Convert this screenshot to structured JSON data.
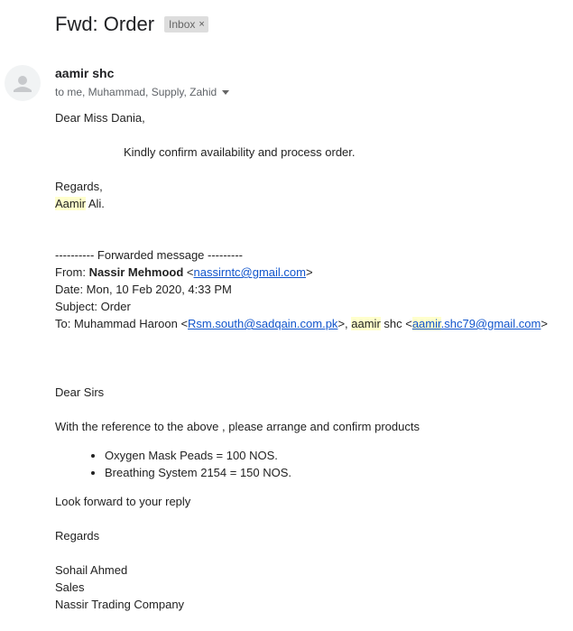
{
  "email": {
    "subject": "Fwd: Order",
    "label": "Inbox",
    "label_close": "×",
    "sender": "aamir shc",
    "recipients": "to me, Muhammad, Supply, Zahid"
  },
  "reply": {
    "greeting": "Dear Miss Dania,",
    "message": "Kindly confirm availability and process order.",
    "regards": "Regards,",
    "sig_first": "Aamir",
    "sig_last": " Ali."
  },
  "forwarded": {
    "header": "---------- Forwarded message ---------",
    "from_label": "From: ",
    "from_name": "Nassir Mehmood",
    "from_email": "nassirntc@gmail.com",
    "date_line": "Date: Mon, 10 Feb 2020, 4:33 PM",
    "subject_line": "Subject: Order",
    "to_label": "To: Muhammad Haroon <",
    "to_email1": "Rsm.south@sadqain.com.pk",
    "to_mid": ">, ",
    "to_name2_hl": "aamir",
    "to_name2_rest": " shc <",
    "to_email2_hl": "aamir",
    "to_email2_rest": ".shc79@gmail.com",
    "to_end": ">"
  },
  "original": {
    "greeting": "Dear Sirs",
    "intro": "With the reference to the above , please arrange and confirm products",
    "items": [
      "Oxygen Mask Peads = 100 NOS.",
      "Breathing System 2154 = 150 NOS."
    ],
    "closing": "Look forward to your reply",
    "regards": "Regards",
    "sig_name": "Sohail Ahmed",
    "sig_dept": "Sales",
    "sig_company": "Nassir Trading Company"
  }
}
